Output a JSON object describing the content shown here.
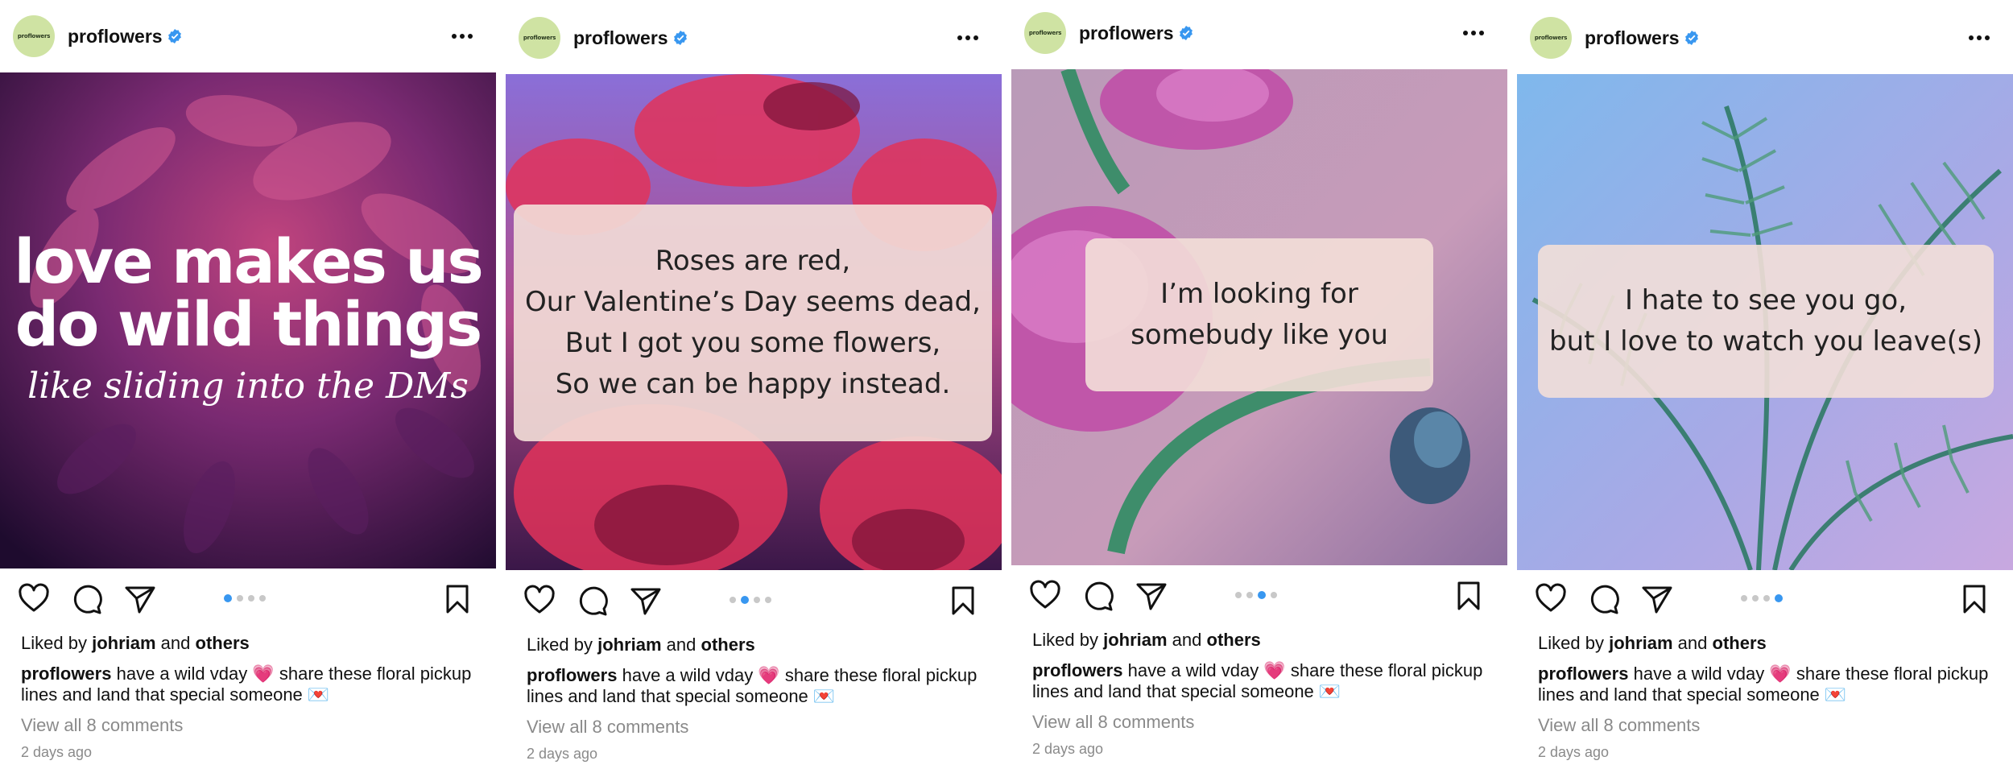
{
  "posts": [
    {
      "username": "proflowers",
      "avatar_text": "proflowers",
      "likes_prefix": "Liked by",
      "liked_by": "johriam",
      "likes_and": "and",
      "likes_others": "others",
      "caption_user": "proflowers",
      "caption_text": "have a wild vday 💗 share these floral pickup lines and land that special someone 💌",
      "comments": "View all 8 comments",
      "time": "2 days ago",
      "carousel_index": 1,
      "carousel_total": 4,
      "slide": {
        "headline_lines": [
          "love makes us",
          "do wild things"
        ],
        "subline": "like sliding into the DMs"
      }
    },
    {
      "username": "proflowers",
      "avatar_text": "proflowers",
      "likes_prefix": "Liked by",
      "liked_by": "johriam",
      "likes_and": "and",
      "likes_others": "others",
      "caption_user": "proflowers",
      "caption_text": "have a wild vday 💗 share these floral pickup lines and land that special someone 💌",
      "comments": "View all 8 comments",
      "time": "2 days ago",
      "carousel_index": 2,
      "carousel_total": 4,
      "slide": {
        "quote_lines": [
          "Roses are red,",
          "Our Valentine’s Day seems dead,",
          "But I got you some flowers,",
          "So we can be happy instead."
        ]
      }
    },
    {
      "username": "proflowers",
      "avatar_text": "proflowers",
      "likes_prefix": "Liked by",
      "liked_by": "johriam",
      "likes_and": "and",
      "likes_others": "others",
      "caption_user": "proflowers",
      "caption_text": "have a wild vday 💗 share these floral pickup lines and land that special someone 💌",
      "comments": "View all 8 comments",
      "time": "2 days ago",
      "carousel_index": 3,
      "carousel_total": 4,
      "slide": {
        "quote_lines": [
          "I’m looking for",
          "somebudy like you"
        ]
      }
    },
    {
      "username": "proflowers",
      "avatar_text": "proflowers",
      "likes_prefix": "Liked by",
      "liked_by": "johriam",
      "likes_and": "and",
      "likes_others": "others",
      "caption_user": "proflowers",
      "caption_text": "have a wild vday 💗 share these floral pickup lines and land that special someone 💌",
      "comments": "View all 8 comments",
      "time": "2 days ago",
      "carousel_index": 4,
      "carousel_total": 4,
      "slide": {
        "quote_lines": [
          "I hate to see you go,",
          "but I love to watch you leave(s)"
        ]
      }
    }
  ],
  "icons": {
    "verified": "verified-badge-icon",
    "more": "more-options-icon",
    "like": "heart-icon",
    "comment": "comment-icon",
    "share": "paper-plane-icon",
    "save": "bookmark-icon"
  },
  "colors": {
    "verified_blue": "#3897f0",
    "carousel_active": "#3897f0",
    "carousel_inactive": "#c8c8c8",
    "muted_text": "#8a8a8a",
    "avatar_bg": "#cfe3a3",
    "quote_box": "#f3dfd8"
  }
}
